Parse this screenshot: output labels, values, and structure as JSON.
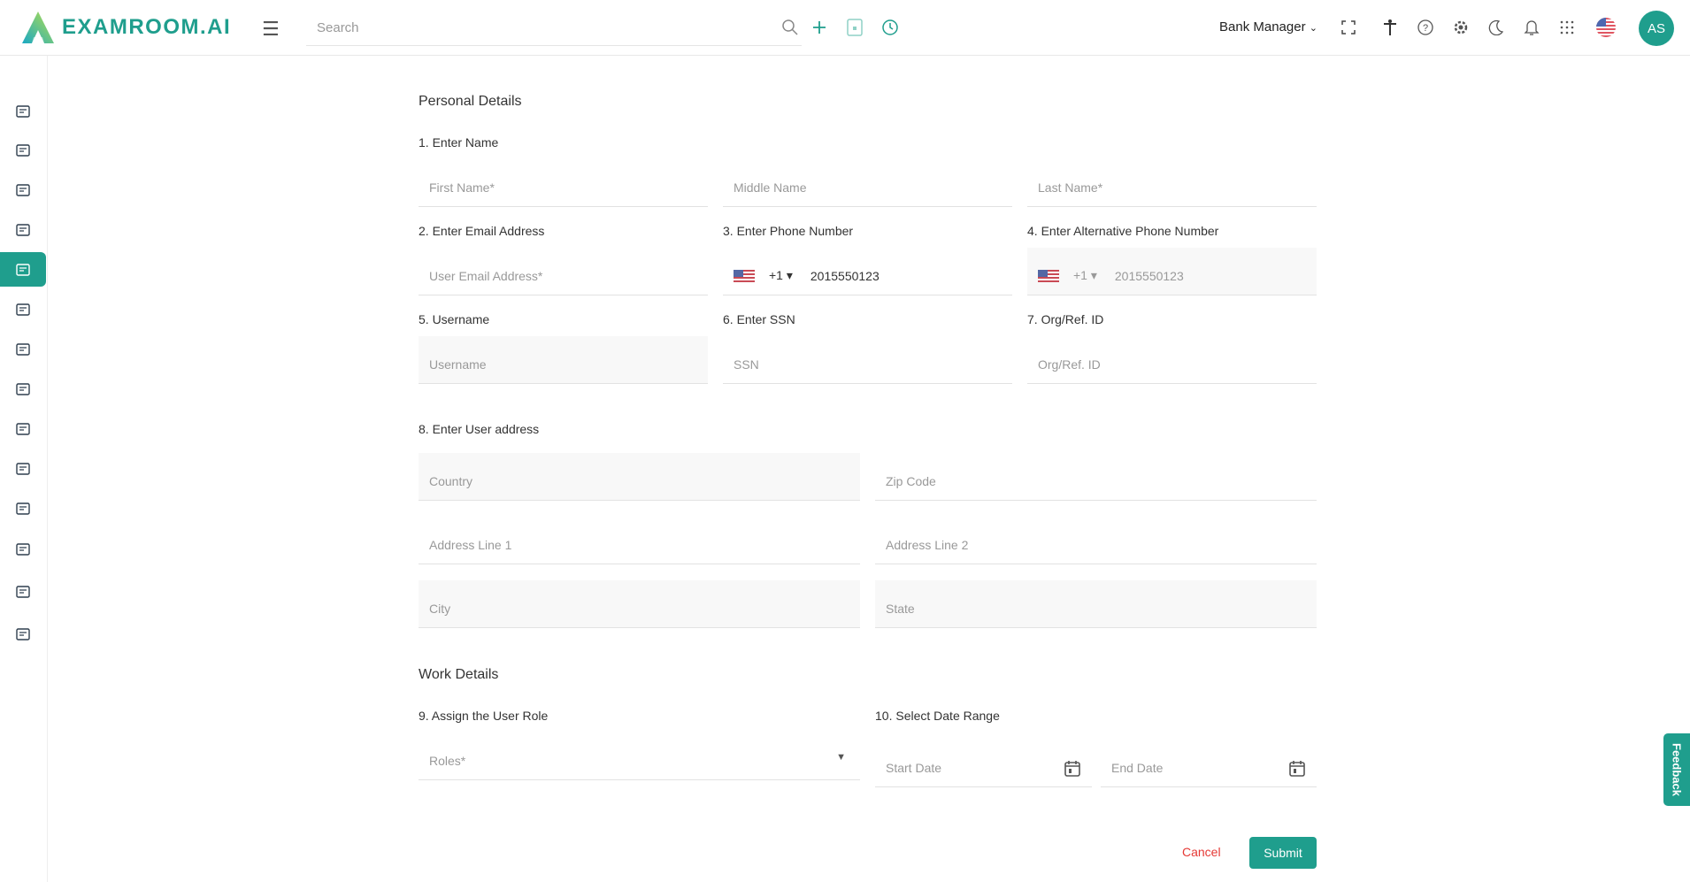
{
  "header": {
    "brand": "EXAMROOM.AI",
    "search_placeholder": "Search",
    "role": "Bank Manager",
    "avatar_initials": "AS"
  },
  "colors": {
    "accent": "#1f9e8d",
    "cancel": "#e53935"
  },
  "sidebar": {
    "items": [
      "servers-icon",
      "bank-icon",
      "add-library-icon",
      "user-settings-icon",
      "user-icon",
      "hierarchy-icon",
      "notes-icon",
      "clipboard-check-icon",
      "report-chart-icon",
      "list-collapse-icon",
      "list-submenu-icon",
      "globe-submenu-icon",
      "server-chat-icon",
      "globe-network-icon"
    ],
    "active_index": 4
  },
  "form": {
    "personal_title": "Personal Details",
    "labels": {
      "name": "1. Enter Name",
      "email": "2. Enter Email Address",
      "phone": "3. Enter Phone Number",
      "alt_phone": "4. Enter Alternative Phone Number",
      "username": "5. Username",
      "ssn": "6. Enter SSN",
      "org": "7. Org/Ref. ID",
      "address": "8. Enter User address",
      "role": "9. Assign the User Role",
      "date": "10. Select Date Range"
    },
    "placeholders": {
      "first": "First Name*",
      "middle": "Middle Name",
      "last": "Last Name*",
      "email": "User Email Address*",
      "username": "Username",
      "ssn": "SSN",
      "org": "Org/Ref. ID",
      "country": "Country",
      "zip": "Zip Code",
      "addr1": "Address Line 1",
      "addr2": "Address Line 2",
      "city": "City",
      "state": "State",
      "roles": "Roles*",
      "start": "Start Date",
      "end": "End Date"
    },
    "phone": {
      "code": "+1",
      "value": "2015550123"
    },
    "alt_phone": {
      "code": "+1",
      "value": "2015550123"
    },
    "work_title": "Work Details",
    "cancel": "Cancel",
    "submit": "Submit"
  },
  "feedback": "Feedback"
}
